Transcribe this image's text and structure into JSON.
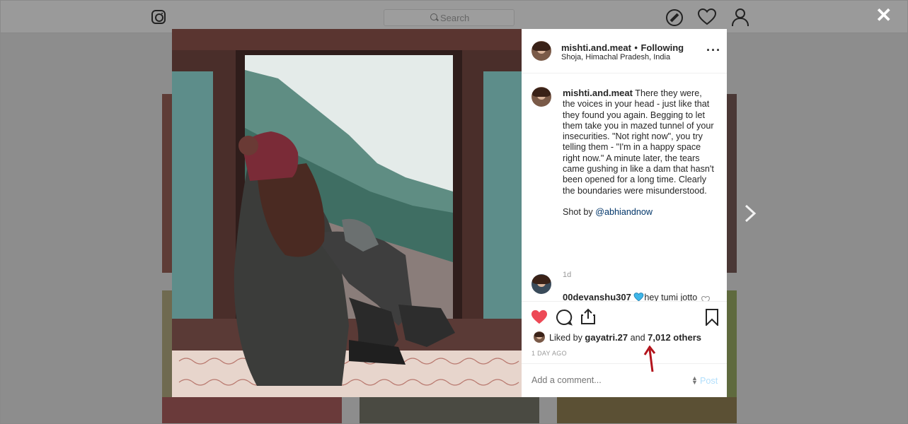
{
  "header": {
    "search_placeholder": "Search"
  },
  "post": {
    "username": "mishti.and.meat",
    "follow_sep": "•",
    "follow_status": "Following",
    "location": "Shoja, Himachal Pradesh, India",
    "caption_text": "There they were, the voices in your head - just like that they found you again. Begging to let them take you in mazed tunnel of your insecurities. \"Not right now\", you try telling them - \"I'm in a happy space right now.\" A minute later, the tears came gushing in like a dam that hasn't been opened for a long time. Clearly the boundaries were misunderstood.",
    "credit_prefix": "Shot by",
    "credit_handle": "@abhiandnow",
    "caption_age": "1d"
  },
  "comments": [
    {
      "username": "00devanshu307",
      "text": "hey tumi jotto kichu bhi likhe cho... tumi kemni kore likhe nao. ...tomar words golo aamake ekdom tomar emotions golo te dhukai dilo. ...u"
    }
  ],
  "likes": {
    "prefix": "Liked by",
    "user": "gayatri.27",
    "and": "and",
    "others": "7,012 others"
  },
  "post_age": "1 DAY AGO",
  "comment_box": {
    "placeholder": "Add a comment...",
    "post_label": "Post"
  },
  "colors": {
    "liked_heart": "#ed4956",
    "link": "#003569",
    "annotation_arrow": "#b3141c"
  }
}
